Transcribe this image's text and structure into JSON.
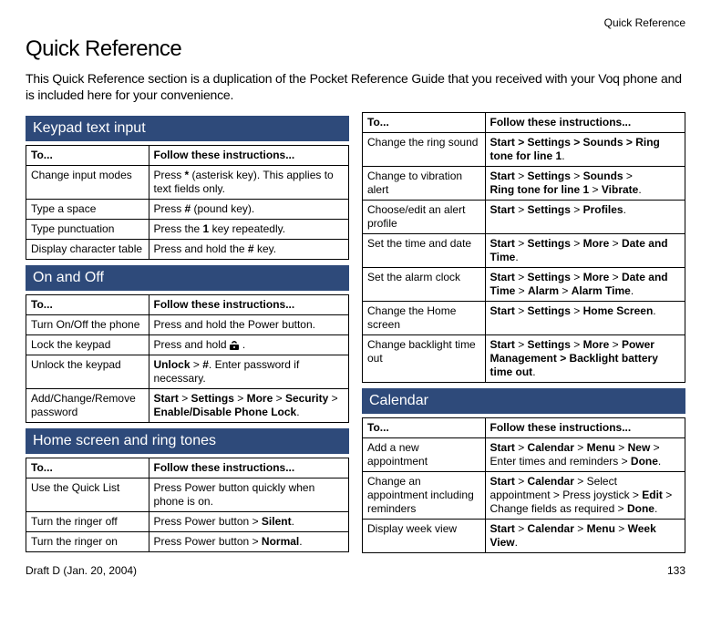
{
  "running_head": "Quick Reference",
  "title": "Quick Reference",
  "intro": "This Quick Reference section is a duplication of the Pocket Reference Guide that you received with your Voq phone and is included here for your convenience.",
  "sections": {
    "keypad": {
      "heading": "Keypad text input",
      "header": {
        "c1": "To...",
        "c2": "Follow these instructions..."
      },
      "rows": [
        {
          "c1": "Change input modes",
          "c2": "Press <b>*</b> (asterisk key). This applies to text fields only."
        },
        {
          "c1": "Type a space",
          "c2": "Press <b>#</b> (pound key)."
        },
        {
          "c1": "Type punctuation",
          "c2": "Press the <b>1</b> key repeatedly."
        },
        {
          "c1": "Display character table",
          "c2": "Press and hold the <b>#</b> key."
        }
      ]
    },
    "onoff": {
      "heading": "On and Off",
      "header": {
        "c1": "To...",
        "c2": "Follow these instructions..."
      },
      "rows": [
        {
          "c1": "Turn On/Off the phone",
          "c2": "Press and hold the Power button."
        },
        {
          "c1": "Lock the keypad",
          "c2": "Press and hold <svg class='end-icon' width='14' height='12' viewBox='0 0 14 12'><path d='M2 3 Q5 -1 8 3 L7 4 Q5 1 3 4 Z' fill='#000'/><rect x='0' y='5' width='10' height='6' rx='1' fill='#000'/><circle cx='5' cy='8' r='1' fill='#fff'/></svg>."
        },
        {
          "c1": "Unlock the keypad",
          "c2": "<b>Unlock</b> > <b>#</b>. Enter password if necessary."
        },
        {
          "c1": "Add/Change/Remove password",
          "c2": "<b>Start</b> > <b>Settings</b> > <b>More</b> > <b>Security</b> > <b>Enable/Disable Phone Lock</b>."
        }
      ]
    },
    "home": {
      "heading": "Home screen and ring tones",
      "header": {
        "c1": "To...",
        "c2": "Follow these instructions..."
      },
      "rows": [
        {
          "c1": "Use the Quick List",
          "c2": "Press Power button quickly when phone is on."
        },
        {
          "c1": "Turn the ringer off",
          "c2": "Press Power button > <b>Silent</b>."
        },
        {
          "c1": "Turn the ringer on",
          "c2": "Press Power button > <b>Normal</b>."
        }
      ]
    },
    "home2": {
      "header": {
        "c1": "To...",
        "c2": "Follow these instructions..."
      },
      "rows": [
        {
          "c1": "Change the ring sound",
          "c2": "<b>Start > Settings > Sounds > Ring tone for line 1</b>."
        },
        {
          "c1": "Change to vibration alert",
          "c2": "<b>Start</b> > <b>Settings</b> > <b>Sounds</b> > <b>Ring&nbsp;tone for line 1</b> > <b>Vibrate</b>."
        },
        {
          "c1": "Choose/edit an alert profile",
          "c2": "<b>Start</b> > <b>Settings</b> > <b>Profiles</b>."
        },
        {
          "c1": "Set the time and date",
          "c2": "<b>Start</b> > <b>Settings</b> > <b>More</b> > <b>Date and Time</b>."
        },
        {
          "c1": "Set the alarm clock",
          "c2": "<b>Start</b> > <b>Settings</b> > <b>More</b> > <b>Date and Time</b> > <b>Alarm</b> > <b>Alarm Time</b>."
        },
        {
          "c1": "Change the Home screen",
          "c2": "<b>Start</b> > <b>Settings</b> > <b>Home Screen</b>."
        },
        {
          "c1": "Change backlight time out",
          "c2": "<b>Start</b> > <b>Settings</b> > <b>More</b> > <b>Power Management > Backlight battery time out</b>."
        }
      ]
    },
    "calendar": {
      "heading": "Calendar",
      "header": {
        "c1": "To...",
        "c2": "Follow these instructions..."
      },
      "rows": [
        {
          "c1": "Add a new appointment",
          "c2": "<b>Start</b> > <b>Calendar</b> > <b>Menu</b> > <b>New</b> > Enter times and reminders > <b>Done</b>."
        },
        {
          "c1": "Change an appointment including reminders",
          "c2": "<b>Start</b> > <b>Calendar</b> > Select appointment > Press joystick > <b>Edit</b> > Change fields as required > <b>Done</b>."
        },
        {
          "c1": "Display week view",
          "c2": "<b>Start</b> > <b>Calendar</b> > <b>Menu</b> > <b>Week View</b>."
        }
      ]
    }
  },
  "footer": {
    "left": "Draft D (Jan. 20, 2004)",
    "right": "133"
  }
}
